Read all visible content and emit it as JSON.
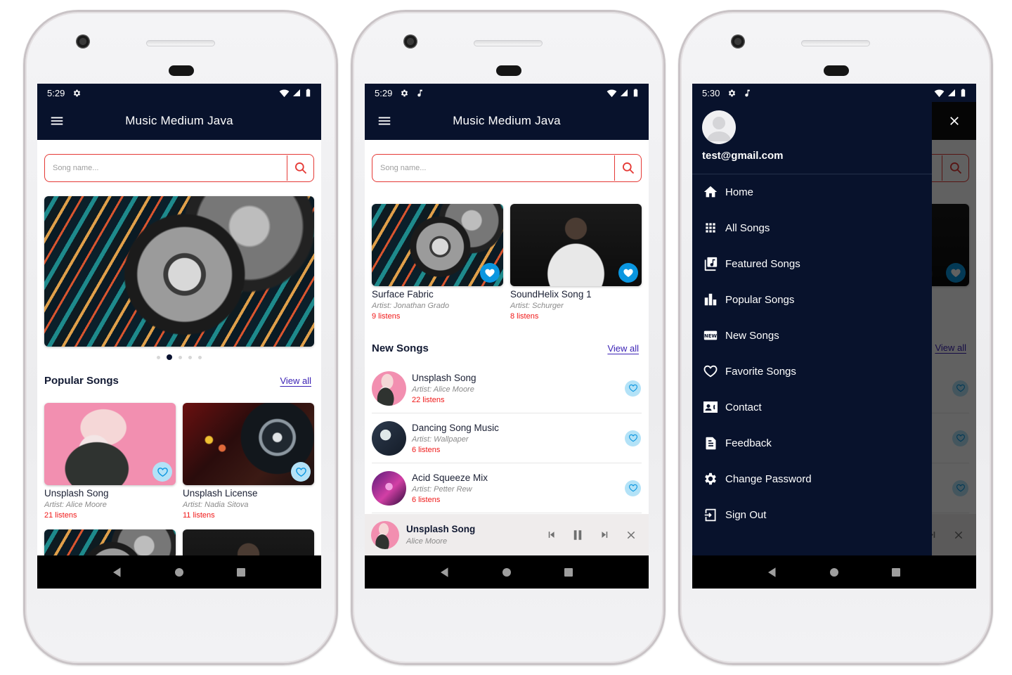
{
  "app": {
    "title": "Music Medium Java",
    "search_placeholder": "Song name...",
    "colors": {
      "primary": "#08122c",
      "accent_red": "#e53935",
      "listens_red": "#f01818",
      "link_purple": "#3b22b5",
      "fav_light": "#b3e2f7",
      "fav_solid": "#0a96e0"
    }
  },
  "screen1": {
    "status": {
      "time": "5:29",
      "icons": [
        "gear-icon",
        "wifi-icon",
        "signal-icon",
        "battery-icon"
      ]
    },
    "banner": {
      "image": "headphones-on-floral-fabric",
      "page_count": 5,
      "active_page": 2
    },
    "popular": {
      "title": "Popular Songs",
      "view_all": "View all",
      "items": [
        {
          "name": "Unsplash Song",
          "artist": "Artist:  Alice Moore",
          "listens": "21 listens",
          "image": "pink-headphones"
        },
        {
          "name": "Unsplash License",
          "artist": "Artist:  Nadia Sitova",
          "listens": "11 listens",
          "image": "dj-deck"
        }
      ]
    }
  },
  "screen2": {
    "status": {
      "time": "5:29",
      "icons": [
        "gear-icon",
        "music-note-icon",
        "wifi-icon",
        "signal-icon",
        "battery-icon"
      ]
    },
    "featured": {
      "items": [
        {
          "name": "Surface Fabric",
          "artist": "Artist:  Jonathan Grado",
          "listens": "9 listens",
          "image": "headphones"
        },
        {
          "name": "SoundHelix Song 1",
          "artist": "Artist:  Schurger",
          "listens": "8 listens",
          "image": "man-hoodie"
        }
      ]
    },
    "new_songs": {
      "title": "New Songs",
      "view_all": "View all",
      "items": [
        {
          "name": "Unsplash Song",
          "artist": "Artist:  Alice Moore",
          "listens": "22 listens",
          "image": "pink-headphones"
        },
        {
          "name": "Dancing Song Music",
          "artist": "Artist:  Wallpaper",
          "listens": "6 listens",
          "image": "guitar"
        },
        {
          "name": "Acid Squeeze Mix",
          "artist": "Artist:  Petter Rew",
          "listens": "6 listens",
          "image": "acid-lights"
        }
      ]
    },
    "player": {
      "title": "Unsplash Song",
      "artist": "Alice Moore",
      "state": "playing"
    }
  },
  "screen3": {
    "status": {
      "time": "5:30",
      "icons": [
        "gear-icon",
        "music-note-icon",
        "wifi-icon",
        "signal-icon",
        "battery-icon"
      ]
    },
    "drawer": {
      "email": "test@gmail.com",
      "items": [
        {
          "label": "Home",
          "icon": "home-icon"
        },
        {
          "label": "All Songs",
          "icon": "grid-icon"
        },
        {
          "label": "Featured Songs",
          "icon": "library-music-icon"
        },
        {
          "label": "Popular Songs",
          "icon": "bar-chart-icon"
        },
        {
          "label": "New Songs",
          "icon": "new-badge-icon"
        },
        {
          "label": "Favorite Songs",
          "icon": "heart-outline-icon"
        },
        {
          "label": "Contact",
          "icon": "contact-icon"
        },
        {
          "label": "Feedback",
          "icon": "document-icon"
        },
        {
          "label": "Change Password",
          "icon": "gear-icon"
        },
        {
          "label": "Sign Out",
          "icon": "sign-out-icon"
        }
      ]
    },
    "behind": {
      "view_all": "View all"
    }
  }
}
